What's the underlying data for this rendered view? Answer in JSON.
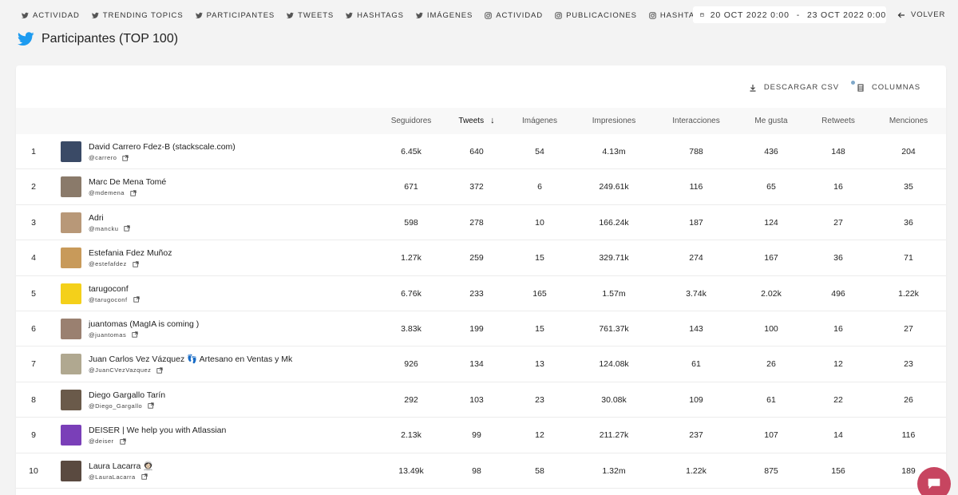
{
  "nav": {
    "items": [
      {
        "label": "Actividad",
        "icon": "twitter-icon"
      },
      {
        "label": "Trending Topics",
        "icon": "twitter-icon"
      },
      {
        "label": "Participantes",
        "icon": "twitter-icon"
      },
      {
        "label": "Tweets",
        "icon": "twitter-icon"
      },
      {
        "label": "Hashtags",
        "icon": "twitter-icon"
      },
      {
        "label": "Imágenes",
        "icon": "twitter-icon"
      },
      {
        "label": "Actividad",
        "icon": "instagram-icon"
      },
      {
        "label": "Publicaciones",
        "icon": "instagram-icon"
      },
      {
        "label": "Hashtags",
        "icon": "instagram-icon"
      }
    ],
    "date_from": "20 OCT 2022 0:00",
    "date_sep": "-",
    "date_to": "23 OCT 2022 0:00",
    "back_label": "VOLVER"
  },
  "page": {
    "title": "Participantes (TOP 100)"
  },
  "toolbar": {
    "download_label": "Descargar CSV",
    "columns_label": "Columnas"
  },
  "table": {
    "headers": {
      "followers": "Seguidores",
      "tweets": "Tweets",
      "images": "Imágenes",
      "impressions": "Impresiones",
      "interactions": "Interacciones",
      "likes": "Me gusta",
      "retweets": "Retweets",
      "mentions": "Menciones"
    },
    "rows": [
      {
        "rank": "1",
        "name": "David Carrero Fdez-B (stackscale.com)",
        "handle": "@carrero",
        "avatar_color": "#3a4a66",
        "followers": "6.45k",
        "tweets": "640",
        "images": "54",
        "impressions": "4.13m",
        "interactions": "788",
        "likes": "436",
        "retweets": "148",
        "mentions": "204"
      },
      {
        "rank": "2",
        "name": "Marc De Mena Tomé",
        "handle": "@mdemena",
        "avatar_color": "#8a7a6a",
        "followers": "671",
        "tweets": "372",
        "images": "6",
        "impressions": "249.61k",
        "interactions": "116",
        "likes": "65",
        "retweets": "16",
        "mentions": "35"
      },
      {
        "rank": "3",
        "name": "Adri",
        "handle": "@mancku",
        "avatar_color": "#b89878",
        "followers": "598",
        "tweets": "278",
        "images": "10",
        "impressions": "166.24k",
        "interactions": "187",
        "likes": "124",
        "retweets": "27",
        "mentions": "36"
      },
      {
        "rank": "4",
        "name": "Estefania Fdez Muñoz",
        "handle": "@estefafdez",
        "avatar_color": "#c89a5a",
        "followers": "1.27k",
        "tweets": "259",
        "images": "15",
        "impressions": "329.71k",
        "interactions": "274",
        "likes": "167",
        "retweets": "36",
        "mentions": "71"
      },
      {
        "rank": "5",
        "name": "tarugoconf",
        "handle": "@tarugoconf",
        "avatar_color": "#f4d01a",
        "followers": "6.76k",
        "tweets": "233",
        "images": "165",
        "impressions": "1.57m",
        "interactions": "3.74k",
        "likes": "2.02k",
        "retweets": "496",
        "mentions": "1.22k"
      },
      {
        "rank": "6",
        "name": "juantomas (MagIA is coming )",
        "handle": "@juantomas",
        "avatar_color": "#9a8070",
        "followers": "3.83k",
        "tweets": "199",
        "images": "15",
        "impressions": "761.37k",
        "interactions": "143",
        "likes": "100",
        "retweets": "16",
        "mentions": "27"
      },
      {
        "rank": "7",
        "name": "Juan Carlos Vez Vázquez 👣 Artesano en Ventas y Mk",
        "handle": "@JuanCVezVazquez",
        "avatar_color": "#b0a890",
        "followers": "926",
        "tweets": "134",
        "images": "13",
        "impressions": "124.08k",
        "interactions": "61",
        "likes": "26",
        "retweets": "12",
        "mentions": "23"
      },
      {
        "rank": "8",
        "name": "Diego Gargallo Tarín",
        "handle": "@Diego_Gargallo",
        "avatar_color": "#6a5a4a",
        "followers": "292",
        "tweets": "103",
        "images": "23",
        "impressions": "30.08k",
        "interactions": "109",
        "likes": "61",
        "retweets": "22",
        "mentions": "26"
      },
      {
        "rank": "9",
        "name": "DEISER | We help you with Atlassian",
        "handle": "@deiser",
        "avatar_color": "#7a3fb8",
        "followers": "2.13k",
        "tweets": "99",
        "images": "12",
        "impressions": "211.27k",
        "interactions": "237",
        "likes": "107",
        "retweets": "14",
        "mentions": "116"
      },
      {
        "rank": "10",
        "name": "Laura Lacarra 👩🏻‍🚀",
        "handle": "@LauraLacarra",
        "avatar_color": "#5a4a40",
        "followers": "13.49k",
        "tweets": "98",
        "images": "58",
        "impressions": "1.32m",
        "interactions": "1.22k",
        "likes": "875",
        "retweets": "156",
        "mentions": "189"
      }
    ]
  },
  "colors": {
    "accent_twitter": "#1d9bf0",
    "chat_bubble": "#c74560"
  }
}
